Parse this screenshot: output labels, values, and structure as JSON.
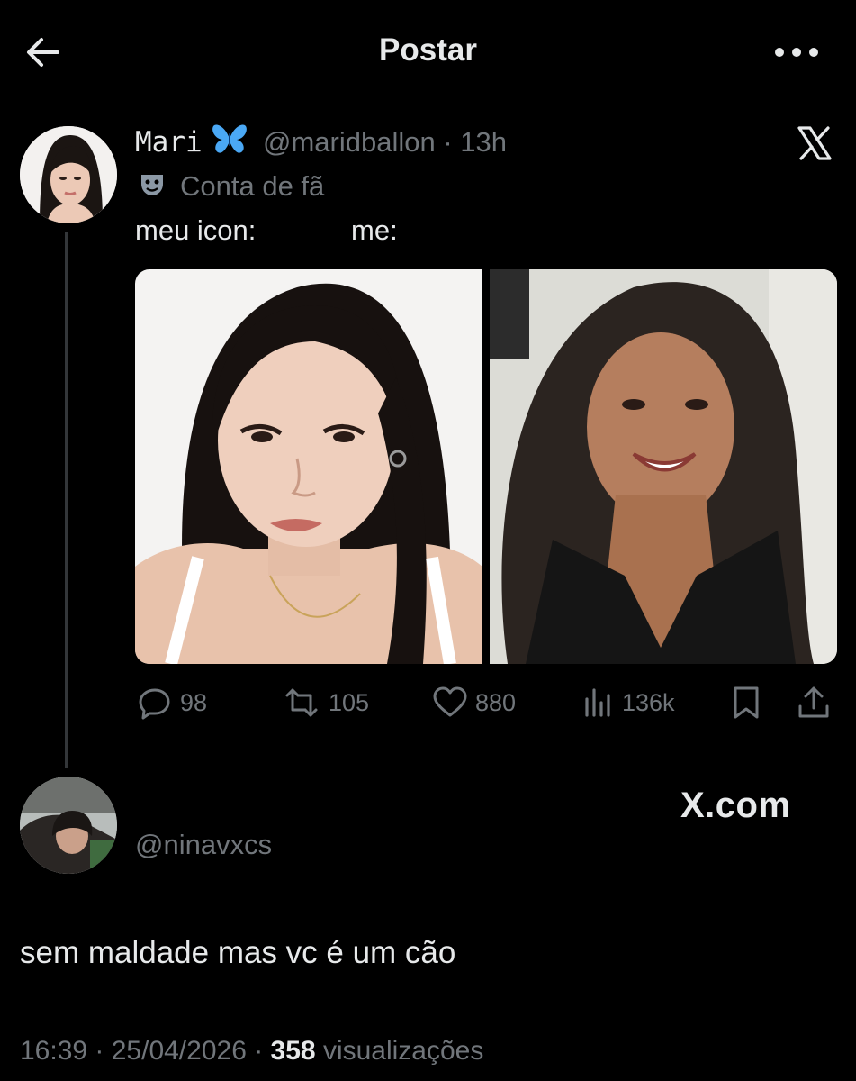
{
  "topbar": {
    "title": "Postar",
    "back_icon": "arrow-left-icon",
    "more_icon": "more-horizontal-icon"
  },
  "post": {
    "display_name": "Mari",
    "name_emoji": "butterfly-icon",
    "handle_time": "@maridballon · 13h",
    "label_icon": "masks-icon",
    "label": "Conta de fã",
    "text_a": "meu icon:",
    "text_b": "me:",
    "actions": {
      "replies": "98",
      "reposts": "105",
      "likes": "880",
      "views": "136k"
    }
  },
  "reply": {
    "handle": "@ninavxcs",
    "text": "sem maldade mas vc é um cão",
    "watermark": "X.com"
  },
  "meta": {
    "time_date": "16:39 · 25/04/2026 · ",
    "views_count": "358",
    "views_label": " visualizações"
  },
  "colors": {
    "background": "#000000",
    "primary_text": "#e7e9ea",
    "secondary_text": "#71767b",
    "thread_line": "#333639",
    "butterfly": "#4aa8f5"
  }
}
